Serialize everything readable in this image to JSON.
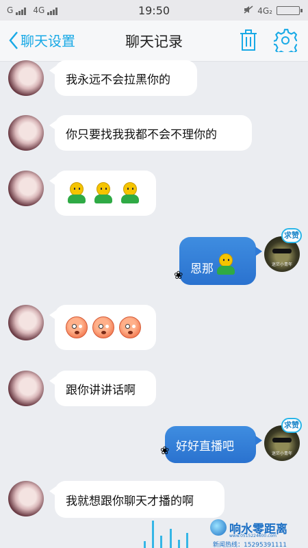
{
  "status_bar": {
    "carrier_left": "G",
    "network": "4G",
    "time": "19:50",
    "network_right": "4G₂"
  },
  "header": {
    "back_label": "聊天设置",
    "title": "聊天记录",
    "accent_color": "#18a9e6",
    "icons": [
      "chevron-left-icon",
      "trash-icon",
      "gear-icon"
    ]
  },
  "messages": [
    {
      "side": "in",
      "text": "我永远不会拉黑你的"
    },
    {
      "side": "in",
      "text": "你只要找我我都不会不理你的"
    },
    {
      "side": "in",
      "text": "",
      "emoji": [
        "person-emoji",
        "person-emoji",
        "person-emoji"
      ]
    },
    {
      "side": "out",
      "text": "恩那",
      "emoji": [
        "person-emoji"
      ],
      "badge": "求赞"
    },
    {
      "side": "in",
      "text": "",
      "emoji": [
        "shocked-face-emoji",
        "shocked-face-emoji",
        "shocked-face-emoji"
      ]
    },
    {
      "side": "in",
      "text": "跟你讲讲话啊"
    },
    {
      "side": "out",
      "text": "好好直播吧",
      "badge": "求赞"
    },
    {
      "side": "in",
      "text": "我就想跟你聊天才播的啊"
    }
  ],
  "avatar_right_caption": "迷茫小青年",
  "watermark": {
    "brand": "响水零距离",
    "url": "www.0515224600.com",
    "hotline": "新闻热线：15295391111"
  }
}
